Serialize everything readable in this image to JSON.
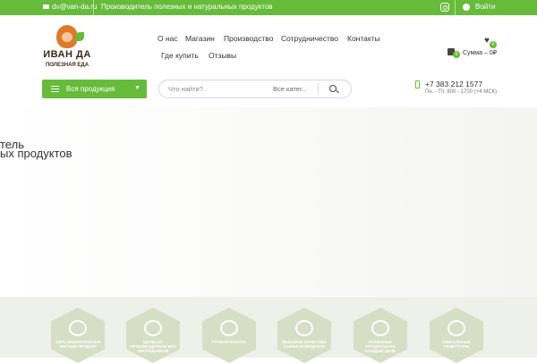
{
  "topbar": {
    "email": "dv@van-da.ru",
    "slogan": "Производитель полезных и натуральных продуктов",
    "login": "Войти"
  },
  "logo": {
    "name": "ИВАН ДА",
    "tagline": "ПОЛЕЗНАЯ ЕДА"
  },
  "nav": {
    "items": [
      "О нас",
      "Магазин",
      "Производство",
      "Сотрудничество",
      "Контакты",
      "Где купить",
      "Отзывы"
    ]
  },
  "cart": {
    "sum_label": "Сумма – 0₽",
    "cart_count": "0",
    "wish_count": "0"
  },
  "catalog": {
    "label": "Вся продукция"
  },
  "search": {
    "placeholder": "Что найти?..",
    "category": "Все катег..."
  },
  "contact": {
    "phone": "+7 383 212 1577",
    "hours": "Пн. - Пт. 800 - 1700 (+4 МСК)"
  },
  "hero": {
    "line1": "тель",
    "line2": "ых продуктов"
  },
  "features": {
    "items": [
      {
        "icon": "magnifier-leaf-icon",
        "caption": "100% ЭКОЛОГИЧЕСКИ ЧИСТЫЙ ПРОДУКТ"
      },
      {
        "icon": "tractor-icon",
        "caption": "ЦЕНЫ ОТ ПРОИЗВОДИТЕЛЯ БЕЗ ПОСРЕДНИКОВ"
      },
      {
        "icon": "hand-icon",
        "caption": "РУЧНАЯ РАБОТА"
      },
      {
        "icon": "wheat-icon",
        "caption": "ВЫСОКОЕ КАЧЕСТВО СЫРЬЯ И ПРОДУКТА"
      },
      {
        "icon": "fruits-icon",
        "caption": "ПОЛЕЗНЫЕ ПРОДУКТЫ НА КАЖДЫЙ ДЕНЬ"
      },
      {
        "icon": "plate-icon",
        "caption": "УНИКАЛЬНЫЕ РЕЦЕПТУРЫ"
      }
    ]
  },
  "colors": {
    "brand_green": "#66bb3a",
    "feature_hex": "#d5dfc5"
  }
}
